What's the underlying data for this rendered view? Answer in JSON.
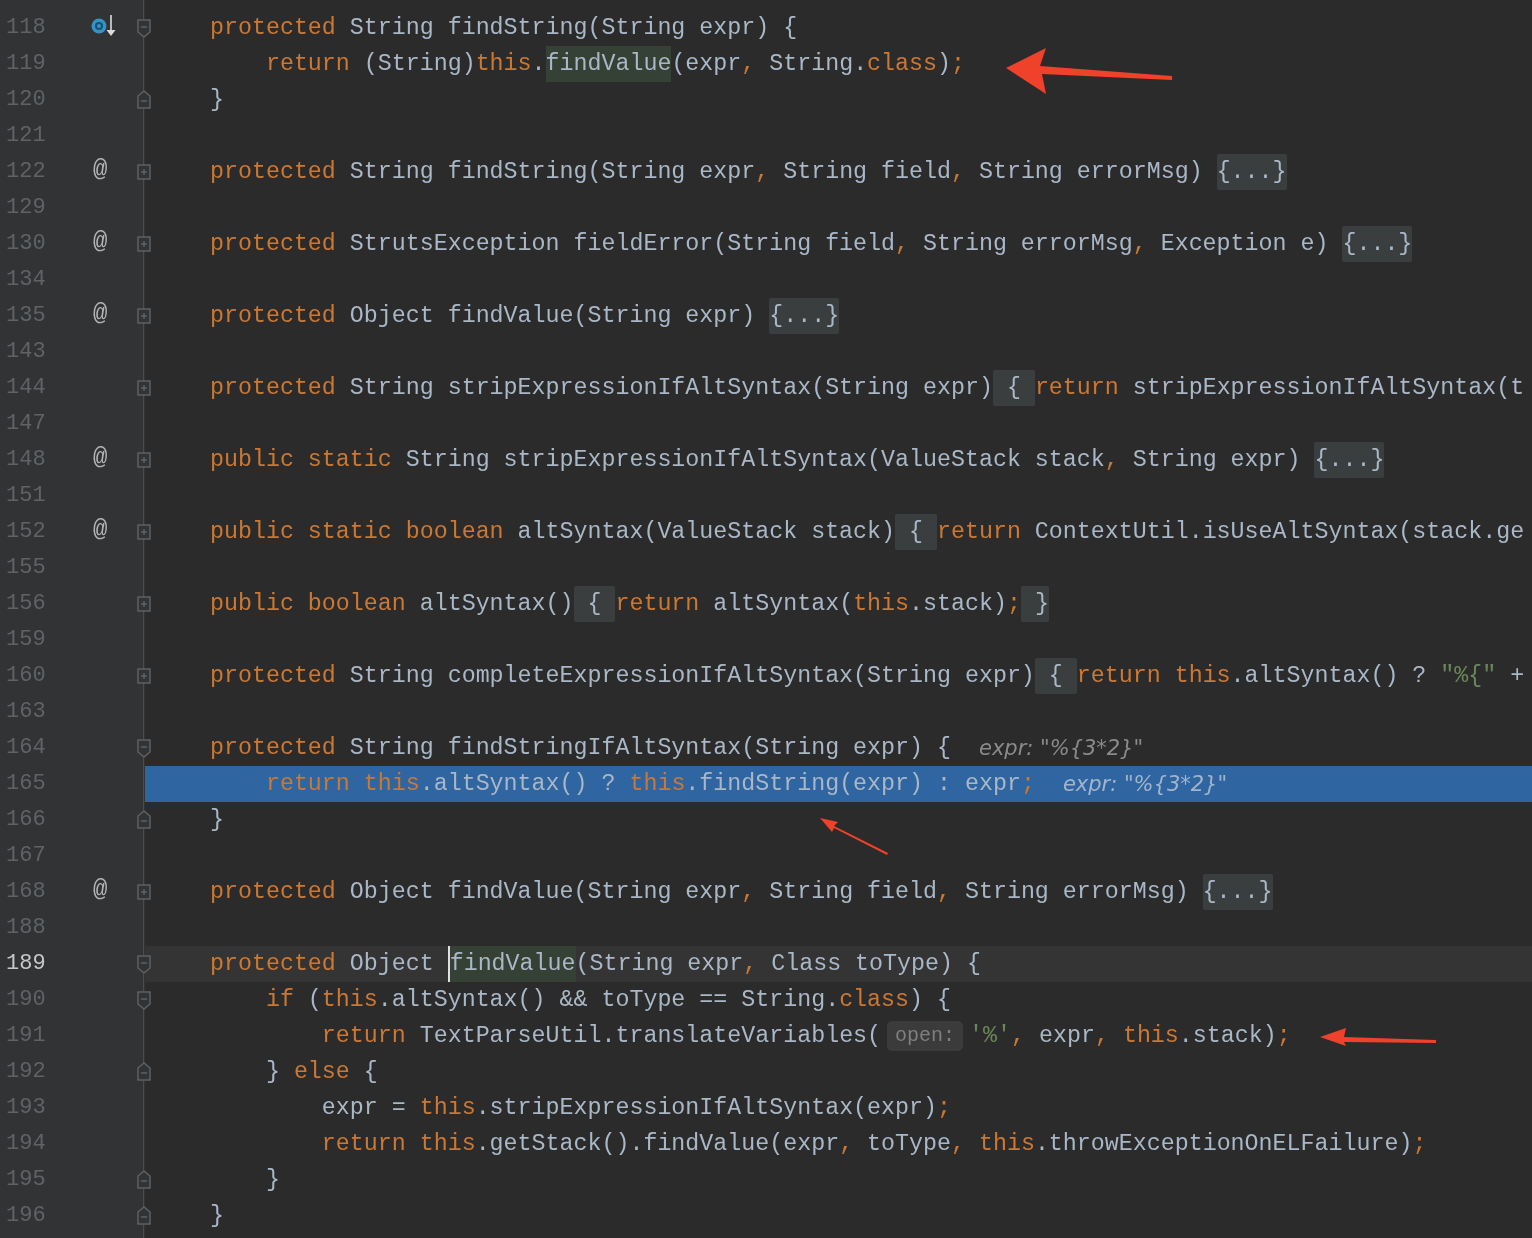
{
  "editor": {
    "lines": [
      {
        "number": "118",
        "fold": {
          "kind": "start"
        },
        "gutter_icon": {
          "kind": "debug"
        },
        "tokens": [
          {
            "kind": "keyword",
            "text": "protected"
          },
          {
            "kind": "plain",
            "text": " String findString(String expr) {"
          }
        ]
      },
      {
        "number": "119",
        "tokens": [
          {
            "kind": "keyword",
            "text": "    return"
          },
          {
            "kind": "plain",
            "text": " (String)"
          },
          {
            "kind": "keyword",
            "text": "this"
          },
          {
            "kind": "plain",
            "text": "."
          },
          {
            "kind": "usage",
            "text": "findValue"
          },
          {
            "kind": "plain",
            "text": "(expr"
          },
          {
            "kind": "keyword",
            "text": ","
          },
          {
            "kind": "plain",
            "text": " String."
          },
          {
            "kind": "keyword",
            "text": "class"
          },
          {
            "kind": "plain",
            "text": ")"
          },
          {
            "kind": "keyword",
            "text": ";"
          }
        ]
      },
      {
        "number": "120",
        "fold": {
          "kind": "end"
        },
        "tokens": [
          {
            "kind": "plain",
            "text": "}"
          }
        ]
      },
      {
        "number": "121"
      },
      {
        "number": "122",
        "fold": {
          "kind": "collapsed"
        },
        "marker": "@",
        "tokens": [
          {
            "kind": "keyword",
            "text": "protected"
          },
          {
            "kind": "plain",
            "text": " String findString(String expr"
          },
          {
            "kind": "keyword",
            "text": ","
          },
          {
            "kind": "plain",
            "text": " String field"
          },
          {
            "kind": "keyword",
            "text": ","
          },
          {
            "kind": "plain",
            "text": " String errorMsg) "
          },
          {
            "kind": "folded",
            "text": "{...}"
          }
        ]
      },
      {
        "number": "129"
      },
      {
        "number": "130",
        "fold": {
          "kind": "collapsed"
        },
        "marker": "@",
        "tokens": [
          {
            "kind": "keyword",
            "text": "protected"
          },
          {
            "kind": "plain",
            "text": " StrutsException fieldError(String field"
          },
          {
            "kind": "keyword",
            "text": ","
          },
          {
            "kind": "plain",
            "text": " String errorMsg"
          },
          {
            "kind": "keyword",
            "text": ","
          },
          {
            "kind": "plain",
            "text": " Exception e) "
          },
          {
            "kind": "folded",
            "text": "{...}"
          }
        ]
      },
      {
        "number": "134"
      },
      {
        "number": "135",
        "fold": {
          "kind": "collapsed"
        },
        "marker": "@",
        "tokens": [
          {
            "kind": "keyword",
            "text": "protected"
          },
          {
            "kind": "plain",
            "text": " Object findValue(String expr) "
          },
          {
            "kind": "folded",
            "text": "{...}"
          }
        ]
      },
      {
        "number": "143"
      },
      {
        "number": "144",
        "fold": {
          "kind": "collapsed"
        },
        "tokens": [
          {
            "kind": "keyword",
            "text": "protected"
          },
          {
            "kind": "plain",
            "text": " String stripExpressionIfAltSyntax(String expr)"
          },
          {
            "kind": "folded",
            "text": " { "
          },
          {
            "kind": "keyword",
            "text": "return"
          },
          {
            "kind": "plain",
            "text": " stripExpressionIfAltSyntax(t"
          }
        ]
      },
      {
        "number": "147"
      },
      {
        "number": "148",
        "fold": {
          "kind": "collapsed"
        },
        "marker": "@",
        "tokens": [
          {
            "kind": "keyword",
            "text": "public static"
          },
          {
            "kind": "plain",
            "text": " String stripExpressionIfAltSyntax(ValueStack stack"
          },
          {
            "kind": "keyword",
            "text": ","
          },
          {
            "kind": "plain",
            "text": " String expr) "
          },
          {
            "kind": "folded",
            "text": "{...}"
          }
        ]
      },
      {
        "number": "151"
      },
      {
        "number": "152",
        "fold": {
          "kind": "collapsed"
        },
        "marker": "@",
        "tokens": [
          {
            "kind": "keyword",
            "text": "public static boolean"
          },
          {
            "kind": "plain",
            "text": " altSyntax(ValueStack stack)"
          },
          {
            "kind": "folded",
            "text": " { "
          },
          {
            "kind": "keyword",
            "text": "return"
          },
          {
            "kind": "plain",
            "text": " ContextUtil.isUseAltSyntax(stack.ge"
          }
        ]
      },
      {
        "number": "155"
      },
      {
        "number": "156",
        "fold": {
          "kind": "collapsed"
        },
        "tokens": [
          {
            "kind": "keyword",
            "text": "public boolean"
          },
          {
            "kind": "plain",
            "text": " altSyntax()"
          },
          {
            "kind": "folded",
            "text": " { "
          },
          {
            "kind": "keyword",
            "text": "return"
          },
          {
            "kind": "plain",
            "text": " altSyntax("
          },
          {
            "kind": "keyword",
            "text": "this"
          },
          {
            "kind": "plain",
            "text": ".stack)"
          },
          {
            "kind": "keyword",
            "text": ";"
          },
          {
            "kind": "folded",
            "text": " }"
          }
        ]
      },
      {
        "number": "159"
      },
      {
        "number": "160",
        "fold": {
          "kind": "collapsed"
        },
        "tokens": [
          {
            "kind": "keyword",
            "text": "protected"
          },
          {
            "kind": "plain",
            "text": " String completeExpressionIfAltSyntax(String expr)"
          },
          {
            "kind": "folded",
            "text": " { "
          },
          {
            "kind": "keyword",
            "text": "return this"
          },
          {
            "kind": "plain",
            "text": ".altSyntax() ? "
          },
          {
            "kind": "string",
            "text": "\"%{\""
          },
          {
            "kind": "plain",
            "text": " +"
          }
        ]
      },
      {
        "number": "163"
      },
      {
        "number": "164",
        "fold": {
          "kind": "start"
        },
        "tokens": [
          {
            "kind": "keyword",
            "text": "protected"
          },
          {
            "kind": "plain",
            "text": " String findStringIfAltSyntax(String expr) {"
          },
          {
            "kind": "hint",
            "text": "expr: \"%{3*2}\""
          }
        ]
      },
      {
        "number": "165",
        "selected": true,
        "tokens": [
          {
            "kind": "keyword",
            "text": "    return this"
          },
          {
            "kind": "plain",
            "text": ".altSyntax() ? "
          },
          {
            "kind": "keyword",
            "text": "this"
          },
          {
            "kind": "plain",
            "text": ".findString(expr) : expr"
          },
          {
            "kind": "keyword",
            "text": ";"
          },
          {
            "kind": "hint",
            "text": "expr: \"%{3*2}\""
          }
        ]
      },
      {
        "number": "166",
        "fold": {
          "kind": "end"
        },
        "tokens": [
          {
            "kind": "plain",
            "text": "}"
          }
        ]
      },
      {
        "number": "167"
      },
      {
        "number": "168",
        "fold": {
          "kind": "collapsed"
        },
        "marker": "@",
        "tokens": [
          {
            "kind": "keyword",
            "text": "protected"
          },
          {
            "kind": "plain",
            "text": " Object findValue(String expr"
          },
          {
            "kind": "keyword",
            "text": ","
          },
          {
            "kind": "plain",
            "text": " String field"
          },
          {
            "kind": "keyword",
            "text": ","
          },
          {
            "kind": "plain",
            "text": " String errorMsg) "
          },
          {
            "kind": "folded",
            "text": "{...}"
          }
        ]
      },
      {
        "number": "188"
      },
      {
        "number": "189",
        "current": true,
        "fold": {
          "kind": "start"
        },
        "tokens": [
          {
            "kind": "keyword",
            "text": "protected"
          },
          {
            "kind": "plain",
            "text": " Object "
          },
          {
            "kind": "usage",
            "text": "findValue",
            "caret": true
          },
          {
            "kind": "plain",
            "text": "(String expr"
          },
          {
            "kind": "keyword",
            "text": ","
          },
          {
            "kind": "plain",
            "text": " Class toType) {"
          }
        ]
      },
      {
        "number": "190",
        "fold": {
          "kind": "start"
        },
        "tokens": [
          {
            "kind": "keyword",
            "text": "    if"
          },
          {
            "kind": "plain",
            "text": " ("
          },
          {
            "kind": "keyword",
            "text": "this"
          },
          {
            "kind": "plain",
            "text": ".altSyntax() && toType == String."
          },
          {
            "kind": "keyword",
            "text": "class"
          },
          {
            "kind": "plain",
            "text": ") {"
          }
        ]
      },
      {
        "number": "191",
        "tokens": [
          {
            "kind": "keyword",
            "text": "        return"
          },
          {
            "kind": "plain",
            "text": " TextParseUtil.translateVariables("
          },
          {
            "kind": "param_hint",
            "text": "open:"
          },
          {
            "kind": "string",
            "text": "'%'"
          },
          {
            "kind": "keyword",
            "text": ","
          },
          {
            "kind": "plain",
            "text": " expr"
          },
          {
            "kind": "keyword",
            "text": ", this"
          },
          {
            "kind": "plain",
            "text": ".stack)"
          },
          {
            "kind": "keyword",
            "text": ";"
          }
        ]
      },
      {
        "number": "192",
        "fold": {
          "kind": "end"
        },
        "tokens": [
          {
            "kind": "plain",
            "text": "    } "
          },
          {
            "kind": "keyword",
            "text": "else"
          },
          {
            "kind": "plain",
            "text": " {"
          }
        ]
      },
      {
        "number": "193",
        "tokens": [
          {
            "kind": "plain",
            "text": "        expr = "
          },
          {
            "kind": "keyword",
            "text": "this"
          },
          {
            "kind": "plain",
            "text": ".stripExpressionIfAltSyntax(expr)"
          },
          {
            "kind": "keyword",
            "text": ";"
          }
        ]
      },
      {
        "number": "194",
        "tokens": [
          {
            "kind": "keyword",
            "text": "        return this"
          },
          {
            "kind": "plain",
            "text": ".getStack().findValue(expr"
          },
          {
            "kind": "keyword",
            "text": ","
          },
          {
            "kind": "plain",
            "text": " toType"
          },
          {
            "kind": "keyword",
            "text": ", this"
          },
          {
            "kind": "plain",
            "text": ".throwExceptionOnELFailure)"
          },
          {
            "kind": "keyword",
            "text": ";"
          }
        ]
      },
      {
        "number": "195",
        "fold": {
          "kind": "end"
        },
        "tokens": [
          {
            "kind": "plain",
            "text": "    }"
          }
        ]
      },
      {
        "number": "196",
        "fold": {
          "kind": "end"
        },
        "tokens": [
          {
            "kind": "plain",
            "text": "}"
          }
        ]
      }
    ]
  }
}
